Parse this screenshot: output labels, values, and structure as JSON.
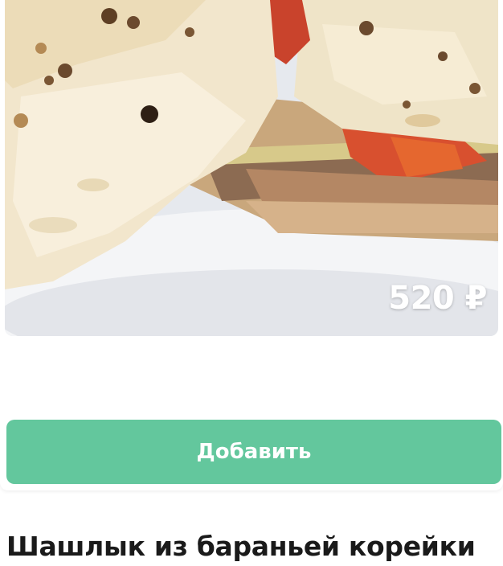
{
  "product": {
    "image_alt": "шаурма",
    "price": "520 ₽",
    "add_button_label": "Добавить"
  },
  "next_product": {
    "title": "Шашлык из бараньей корейки"
  },
  "colors": {
    "accent": "#63c79d",
    "price_text": "#ffffff",
    "title_text": "#1a1a1a"
  }
}
